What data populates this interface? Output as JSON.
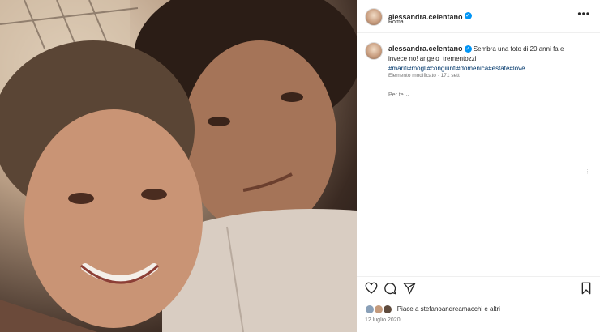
{
  "post": {
    "photo_alt": "Selfie di coppia"
  },
  "header": {
    "username": "alessandra.celentano",
    "location": "Roma",
    "more_label": "•••"
  },
  "caption": {
    "username": "alessandra.celentano",
    "text": "Sembra una foto di 20 anni fa e invece no! angelo_trementozzi",
    "hashtags": "#mariti#mogli#congiunti#domenica#estate#love",
    "meta": "Elemento modificato · 171 sett",
    "translation_label": "Per te"
  },
  "engagement": {
    "likes_text": "Piace a stefanoandreamacchi e altri",
    "date": "12 luglio 2020"
  },
  "icons": [
    "heart-icon",
    "comment-icon",
    "share-icon",
    "bookmark-icon",
    "more-icon",
    "verified-badge-icon"
  ],
  "colors": {
    "verified": "#0095f6",
    "link": "#00376b",
    "muted": "#737373"
  }
}
